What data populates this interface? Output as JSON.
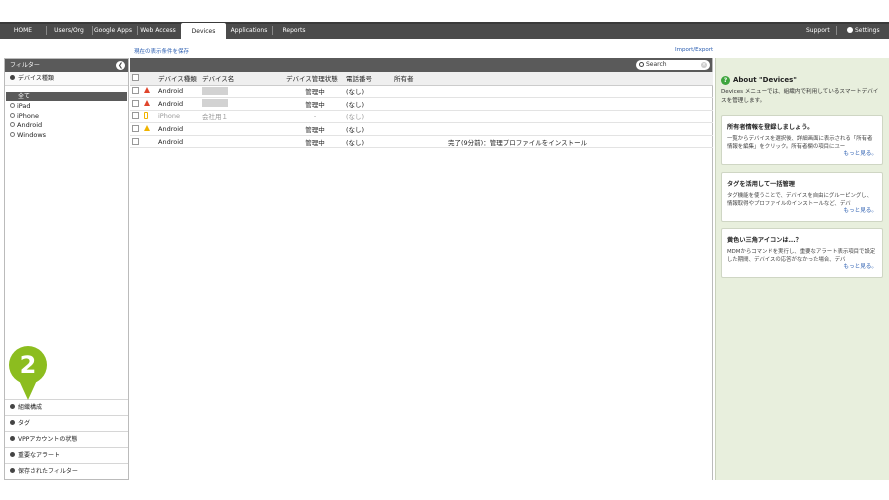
{
  "nav": {
    "tabs": [
      "HOME",
      "Users/Org",
      "Google Apps",
      "Web Access",
      "Devices",
      "Applications",
      "Reports"
    ],
    "active": "Devices",
    "support": "Support",
    "settings": "Settings"
  },
  "links": {
    "save_view": "現在の表示条件を保存",
    "import_export": "Import/Export"
  },
  "sidebar": {
    "header": "フィルター",
    "collapse_glyph": "❮",
    "device_type_section": "デバイス種類",
    "all": "全て",
    "items": [
      "iPad",
      "iPhone",
      "Android",
      "Windows"
    ],
    "bottom_sections": [
      "組織構成",
      "タグ",
      "VPPアカウントの状態",
      "重要なアラート",
      "保存されたフィルター"
    ]
  },
  "callout": {
    "number": "2",
    "color": "#8cbd1f"
  },
  "search": {
    "placeholder": "Search"
  },
  "table": {
    "headers": [
      "デバイス種類",
      "デバイス名",
      "デバイス管理状態",
      "電話番号",
      "所有者"
    ],
    "rows": [
      {
        "icon": "warning-red-icon",
        "type": "Android",
        "name": "",
        "status": "管理中",
        "phone": "(なし)",
        "owner": "",
        "note": ""
      },
      {
        "icon": "warning-red-icon",
        "type": "Android",
        "name": "",
        "status": "管理中",
        "phone": "(なし)",
        "owner": "",
        "note": ""
      },
      {
        "icon": "iphone-icon",
        "type": "iPhone",
        "name": "会社用１",
        "status": "-",
        "phone": "(なし)",
        "owner": "",
        "note": ""
      },
      {
        "icon": "warning-yellow-icon",
        "type": "Android",
        "name": "",
        "status": "管理中",
        "phone": "(なし)",
        "owner": "",
        "note": ""
      },
      {
        "icon": "",
        "type": "Android",
        "name": "",
        "status": "管理中",
        "phone": "(なし)",
        "owner": "",
        "note": "完了(9分前)：管理プロファイルをインストール"
      }
    ]
  },
  "right_panel": {
    "title": "About \"Devices\"",
    "description": "Devices メニューでは、組織内で利用しているスマートデバイスを管理します。",
    "cards": [
      {
        "title": "所有者情報を登録しましょう。",
        "body": "一覧からデバイスを選択後、詳細画面に表示される「所有者情報を編集」をクリック。所有者欄の項目にユー",
        "more": "もっと見る。"
      },
      {
        "title": "タグを活用して一括管理",
        "body": "タグ機能を使うことで、デバイスを自由にグルーピングし、情報取得やプロファイルのインストールなど、デバ",
        "more": "もっと見る。"
      },
      {
        "title": "黄色い三角アイコンは...？",
        "body": "MDMからコマンドを実行し、重要なアラート表示項目で設定した期間、デバイスの応答がなかった場合、デバ",
        "more": "もっと見る。"
      }
    ]
  }
}
